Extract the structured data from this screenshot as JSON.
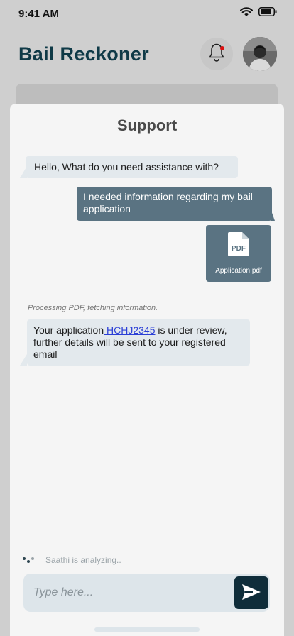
{
  "status": {
    "time": "9:41 AM"
  },
  "header": {
    "title": "Bail Reckoner"
  },
  "support": {
    "title": "Support",
    "messages": {
      "greeting": "Hello, What do you need assistance with?",
      "user_request": "I needed information regarding my bail application",
      "attachment_name": "Application.pdf",
      "attachment_type": "PDF",
      "processing_note": "Processing PDF, fetching information.",
      "reply_prefix": "Your application",
      "reply_link": " HCHJ2345",
      "reply_suffix": " is under review, further details will be sent to your registered email"
    },
    "typing_status": "Saathi is analyzing..",
    "composer": {
      "placeholder": "Type here..."
    }
  },
  "colors": {
    "brand": "#0f3a47",
    "incoming_bubble": "#e3e9ed",
    "outgoing_bubble": "#5a7382",
    "send_button": "#0f2d3a",
    "link": "#2b3fd6",
    "notification_dot": "#dd1111"
  },
  "icons": {
    "wifi": "wifi-icon",
    "battery": "battery-icon",
    "bell": "bell-icon",
    "pdf": "pdf-file-icon",
    "send": "send-icon",
    "typing": "typing-dots-icon"
  }
}
